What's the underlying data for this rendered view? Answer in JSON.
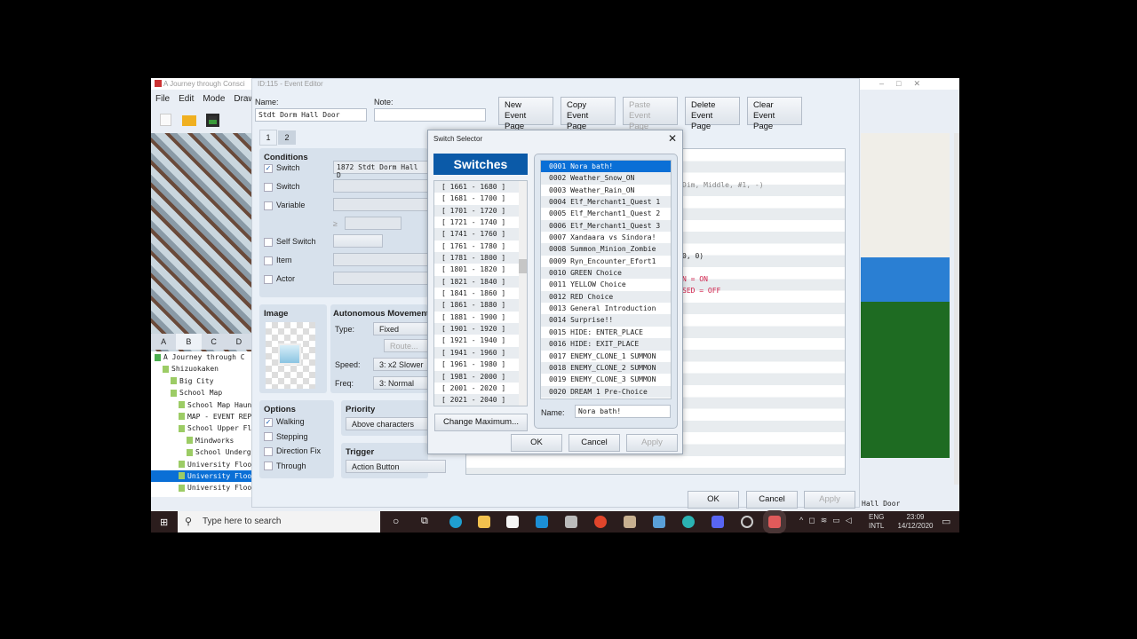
{
  "app": {
    "title": "A Journey through Consci",
    "menu": [
      "File",
      "Edit",
      "Mode",
      "Draw"
    ],
    "tile_tabs": [
      "A",
      "B",
      "C",
      "D"
    ],
    "tree": [
      {
        "label": "A Journey through C",
        "depth": 0
      },
      {
        "label": "Shizuokaken",
        "depth": 1
      },
      {
        "label": "Big City",
        "depth": 2
      },
      {
        "label": "School Map",
        "depth": 2
      },
      {
        "label": "School Map Haun",
        "depth": 3
      },
      {
        "label": "MAP - EVENT REP",
        "depth": 3
      },
      {
        "label": "School Upper Fl",
        "depth": 3
      },
      {
        "label": "Mindworks",
        "depth": 4
      },
      {
        "label": "School Undergr",
        "depth": 4
      },
      {
        "label": "University Floo",
        "depth": 3
      },
      {
        "label": "University Floo",
        "depth": 3,
        "selected": true
      },
      {
        "label": "University Floo",
        "depth": 3
      }
    ],
    "status": "Hall Door"
  },
  "editor": {
    "title": "ID:115 - Event Editor",
    "name_label": "Name:",
    "name_value": "Stdt Dorm Hall Door",
    "note_label": "Note:",
    "note_value": "",
    "buttons": [
      {
        "l1": "New",
        "l2": "Event Page",
        "disabled": false
      },
      {
        "l1": "Copy",
        "l2": "Event Page",
        "disabled": false
      },
      {
        "l1": "Paste",
        "l2": "Event Page",
        "disabled": true
      },
      {
        "l1": "Delete",
        "l2": "Event Page",
        "disabled": false
      },
      {
        "l1": "Clear",
        "l2": "Event Page",
        "disabled": false
      }
    ],
    "tabs": [
      "1",
      "2"
    ],
    "conditions": {
      "title": "Conditions",
      "rows": [
        {
          "label": "Switch",
          "checked": true,
          "value": "1872 Stdt Dorm Hall D"
        },
        {
          "label": "Switch",
          "checked": false,
          "value": ""
        },
        {
          "label": "Variable",
          "checked": false,
          "value": ""
        },
        {
          "label": "Self Switch",
          "checked": false,
          "value": ""
        },
        {
          "label": "Item",
          "checked": false,
          "value": ""
        },
        {
          "label": "Actor",
          "checked": false,
          "value": ""
        }
      ],
      "ge": "≥"
    },
    "image_title": "Image",
    "movement": {
      "title": "Autonomous Movement",
      "type_label": "Type:",
      "type": "Fixed",
      "route": "Route...",
      "speed_label": "Speed:",
      "speed": "3: x2 Slower",
      "freq_label": "Freq:",
      "freq": "3: Normal"
    },
    "options": {
      "title": "Options",
      "items": [
        {
          "label": "Walking",
          "checked": true
        },
        {
          "label": "Stepping",
          "checked": false
        },
        {
          "label": "Direction Fix",
          "checked": false
        },
        {
          "label": "Through",
          "checked": false
        }
      ]
    },
    "priority": {
      "title": "Priority",
      "value": "Above characters"
    },
    "trigger": {
      "title": "Trigger",
      "value": "Action Button"
    },
    "contents": [
      "Dim, Middle, #1, -)",
      "0, 0)",
      "N = ON",
      "SED = OFF"
    ],
    "ok": "OK",
    "cancel": "Cancel",
    "apply": "Apply"
  },
  "dialog": {
    "title": "Switch Selector",
    "header": "Switches",
    "ranges": [
      "[ 1661 - 1680 ]",
      "[ 1681 - 1700 ]",
      "[ 1701 - 1720 ]",
      "[ 1721 - 1740 ]",
      "[ 1741 - 1760 ]",
      "[ 1761 - 1780 ]",
      "[ 1781 - 1800 ]",
      "[ 1801 - 1820 ]",
      "[ 1821 - 1840 ]",
      "[ 1841 - 1860 ]",
      "[ 1861 - 1880 ]",
      "[ 1881 - 1900 ]",
      "[ 1901 - 1920 ]",
      "[ 1921 - 1940 ]",
      "[ 1941 - 1960 ]",
      "[ 1961 - 1980 ]",
      "[ 1981 - 2000 ]",
      "[ 2001 - 2020 ]",
      "[ 2021 - 2040 ]"
    ],
    "switches": [
      "0001 Nora bath!",
      "0002 Weather_Snow_ON",
      "0003 Weather_Rain_ON",
      "0004 Elf_Merchant1_Quest 1",
      "0005 Elf_Merchant1_Quest 2",
      "0006 Elf_Merchant1_Quest 3",
      "0007 Xandaara vs Sindora!",
      "0008 Summon_Minion_Zombie",
      "0009 Ryn_Encounter_Efort1",
      "0010 GREEN Choice",
      "0011 YELLOW Choice",
      "0012 RED Choice",
      "0013 General Introduction",
      "0014 Surprise!!",
      "0015 HIDE: ENTER_PLACE",
      "0016 HIDE: EXIT_PLACE",
      "0017 ENEMY_CLONE_1 SUMMON",
      "0018 ENEMY_CLONE_2 SUMMON",
      "0019 ENEMY_CLONE_3 SUMMON",
      "0020 DREAM 1 Pre-Choice"
    ],
    "selected_index": 0,
    "change_max": "Change Maximum...",
    "name_label": "Name:",
    "name_value": "Nora bath!",
    "ok": "OK",
    "cancel": "Cancel",
    "apply": "Apply"
  },
  "taskbar": {
    "search_placeholder": "Type here to search",
    "lang1": "ENG",
    "lang2": "INTL",
    "time": "23:09",
    "date": "14/12/2020"
  }
}
